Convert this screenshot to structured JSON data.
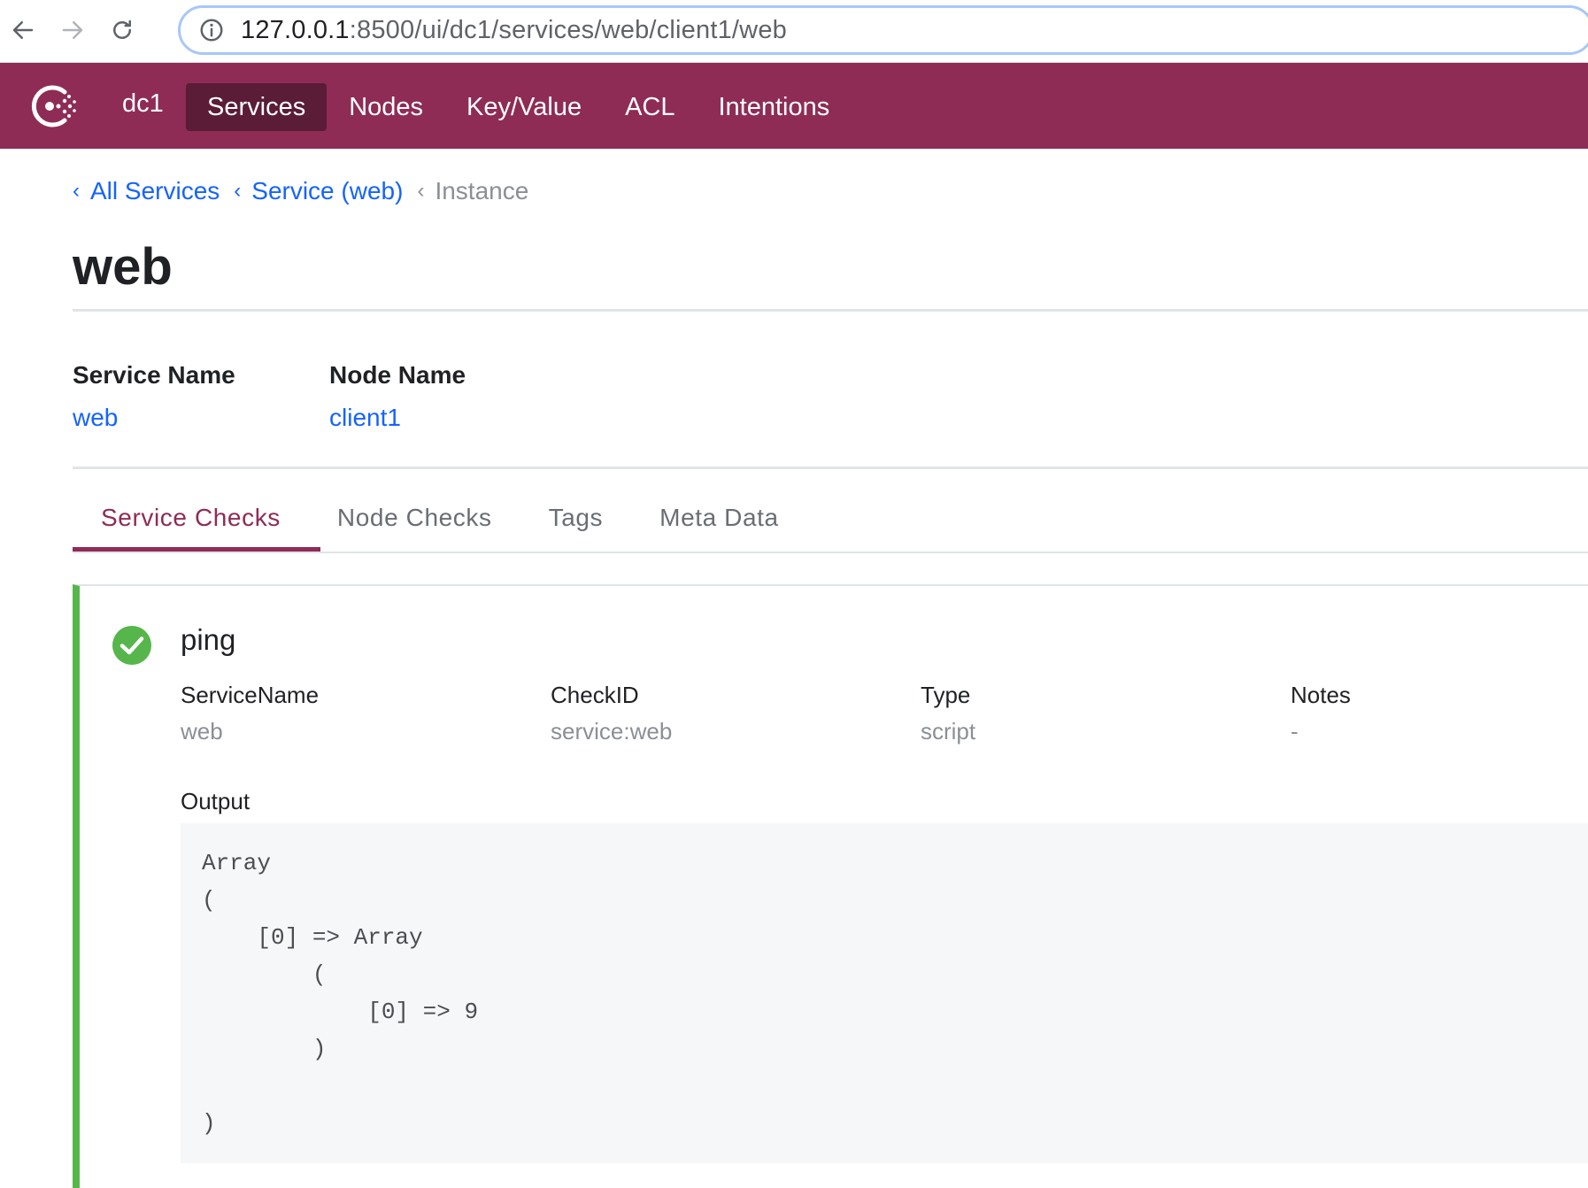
{
  "browser": {
    "url_host": "127.0.0.1",
    "url_path": ":8500/ui/dc1/services/web/client1/web"
  },
  "header": {
    "datacenter": "dc1",
    "nav": [
      {
        "label": "Services",
        "active": true
      },
      {
        "label": "Nodes",
        "active": false
      },
      {
        "label": "Key/Value",
        "active": false
      },
      {
        "label": "ACL",
        "active": false
      },
      {
        "label": "Intentions",
        "active": false
      }
    ],
    "accent_color": "#8e2c56"
  },
  "breadcrumb": [
    {
      "label": "All Services"
    },
    {
      "label": "Service (web)"
    },
    {
      "label": "Instance"
    }
  ],
  "page_title": "web",
  "meta": {
    "service_name_label": "Service Name",
    "service_name_value": "web",
    "node_name_label": "Node Name",
    "node_name_value": "client1"
  },
  "tabs": [
    {
      "label": "Service Checks",
      "active": true
    },
    {
      "label": "Node Checks",
      "active": false
    },
    {
      "label": "Tags",
      "active": false
    },
    {
      "label": "Meta Data",
      "active": false
    }
  ],
  "check": {
    "status_color": "#57b64b",
    "status_icon": "check-circle-icon",
    "name": "ping",
    "fields": [
      {
        "label": "ServiceName",
        "value": "web"
      },
      {
        "label": "CheckID",
        "value": "service:web"
      },
      {
        "label": "Type",
        "value": "script"
      },
      {
        "label": "Notes",
        "value": "-"
      }
    ],
    "output_label": "Output",
    "output": "Array\n(\n    [0] => Array\n        (\n            [0] => 9\n        )\n\n)"
  }
}
